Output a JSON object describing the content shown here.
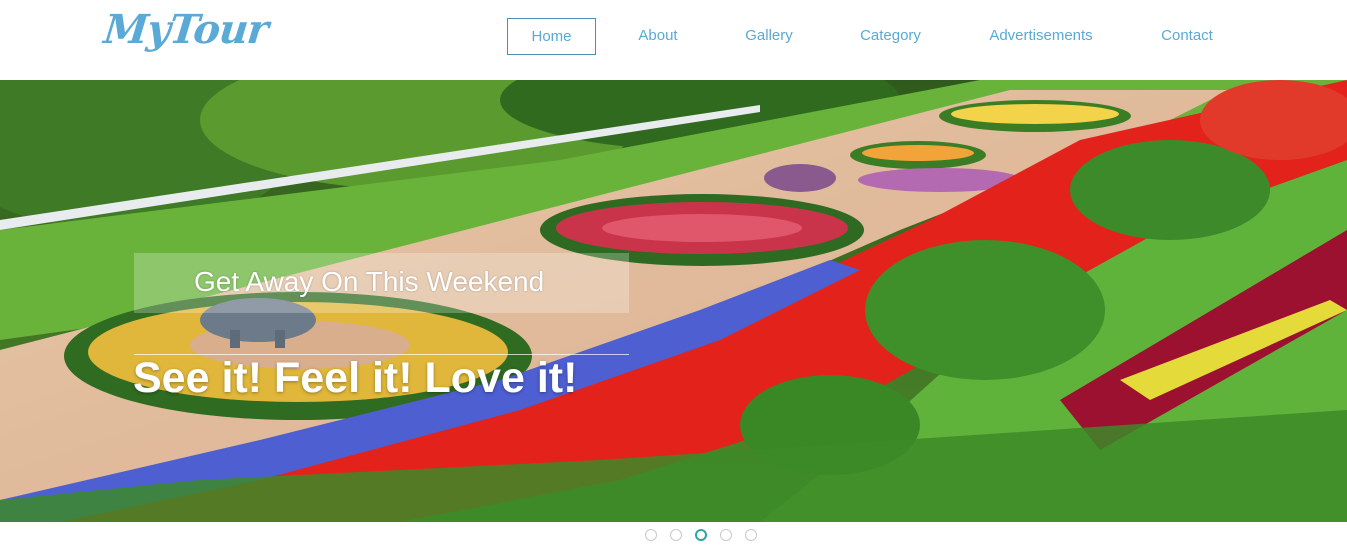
{
  "header": {
    "logo": "MyTour",
    "nav": [
      {
        "label": "Home",
        "active": true
      },
      {
        "label": "About",
        "active": false
      },
      {
        "label": "Gallery",
        "active": false
      },
      {
        "label": "Category",
        "active": false
      },
      {
        "label": "Advertisements",
        "active": false
      },
      {
        "label": "Contact",
        "active": false
      }
    ]
  },
  "hero": {
    "subtitle": "Get Away On This Weekend",
    "headline": "See it! Feel it! Love it!",
    "image": "flower-garden-photo"
  },
  "slider": {
    "slide_count": 5,
    "active_index": 2
  },
  "colors": {
    "brand": "#5aa9d6",
    "nav_active_border": "#4a8fb5",
    "dot_active": "#2ea5a5"
  }
}
